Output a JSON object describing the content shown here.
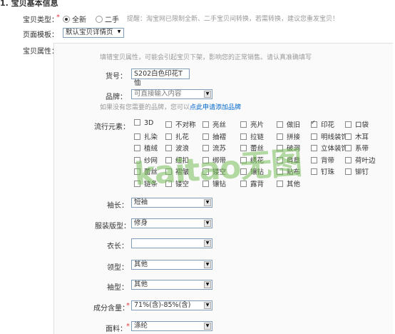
{
  "section_title": "1. 宝贝基本信息",
  "type": {
    "label": "宝贝类型：",
    "required_mark": "*",
    "options": [
      "全新",
      "二手"
    ],
    "selected": "全新",
    "hint": "提醒：淘宝网已限制全新、二手宝贝间转换，若需转换，建议您重发宝贝！"
  },
  "template": {
    "label": "页面模板：",
    "value": "默认宝贝详情页"
  },
  "props": {
    "label": "宝贝属性：",
    "hint": "填错宝贝属性，可能会引起宝贝下架，影响您的正常销售。请认真准确填写",
    "item_no": {
      "label": "货号：",
      "value": "S202白色印花T恤"
    },
    "brand": {
      "label": "品牌：",
      "value": "可直接输入内容"
    },
    "brand_tip": {
      "text": "如果没有您需要的品牌，您可以",
      "link": "点此申请添加品牌"
    },
    "elements": {
      "label": "流行元素：",
      "options": [
        [
          "3D",
          "不对称",
          "亮丝",
          "亮片",
          "做旧",
          "印花",
          "口袋"
        ],
        [
          "扎染",
          "扎花",
          "抽褶",
          "拉链",
          "拼接",
          "明线装饰",
          "木耳"
        ],
        [
          "植绒",
          "波浪",
          "流苏",
          "蕾丝",
          "破洞",
          "立体装饰",
          "系带"
        ],
        [
          "纱网",
          "纽扣",
          "绑带",
          "绣花",
          "肩章",
          "背带",
          "荷叶边"
        ],
        [
          "蕾丝",
          "褶皱",
          "镂空",
          "镶钻",
          "贴布",
          "钉珠",
          "铆钉"
        ],
        [
          "链条",
          "镂空",
          "镶钻",
          "露背",
          "其他"
        ]
      ],
      "checked": [
        "印花"
      ]
    },
    "sleeve_length": {
      "label": "袖长：",
      "value": "短袖"
    },
    "fit": {
      "label": "服装版型：",
      "value": "修身"
    },
    "length": {
      "label": "衣长：",
      "value": ""
    },
    "collar": {
      "label": "领型：",
      "value": "其他"
    },
    "sleeve_type": {
      "label": "袖型：",
      "value": "其他"
    },
    "composition": {
      "label": "成分含量：",
      "required_mark": "*",
      "value": "71%(含)-85%(含)"
    },
    "fabric": {
      "label": "面料：",
      "required_mark": "*",
      "value": "涤纶"
    }
  },
  "watermark": "kaitao无图"
}
